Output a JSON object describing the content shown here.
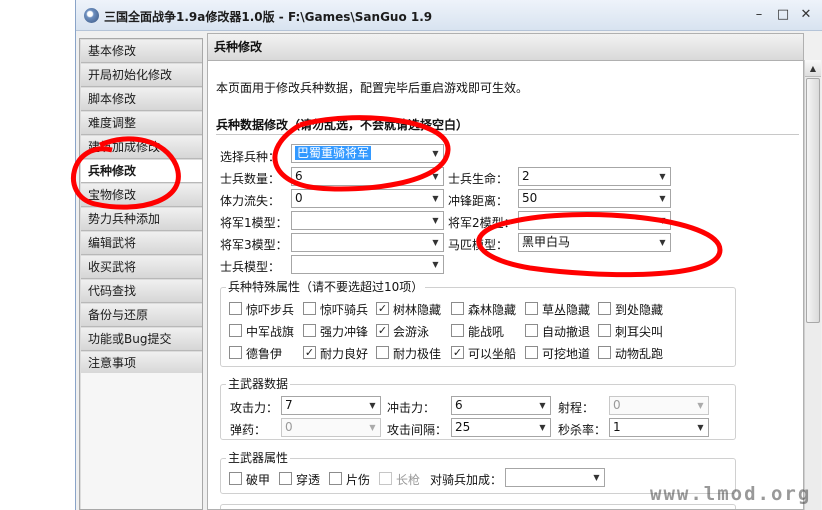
{
  "window": {
    "title": "三国全面战争1.9a修改器1.0版 - F:\\Games\\SanGuo 1.9",
    "minimize_glyph": "–",
    "maximize_glyph": "□",
    "close_glyph": "✕"
  },
  "sidebar": {
    "items": [
      {
        "label": "基本修改"
      },
      {
        "label": "开局初始化修改"
      },
      {
        "label": "脚本修改"
      },
      {
        "label": "难度调整"
      },
      {
        "label": "建筑加成修改"
      },
      {
        "label": "兵种修改",
        "active": true
      },
      {
        "label": "宝物修改"
      },
      {
        "label": "势力兵种添加"
      },
      {
        "label": "编辑武将"
      },
      {
        "label": "收买武将"
      },
      {
        "label": "代码查找"
      },
      {
        "label": "备份与还原"
      },
      {
        "label": "功能或Bug提交"
      },
      {
        "label": "注意事项"
      }
    ]
  },
  "page": {
    "title": "兵种修改",
    "description": "本页面用于修改兵种数据，配置完毕后重启游戏即可生效。",
    "section_title": "兵种数据修改（请勿乱选，不会就请选择空白）"
  },
  "unit_form": {
    "select_label": "选择兵种：",
    "select_value": "巴蜀重骑将军",
    "rows": [
      {
        "left_label": "士兵数量：",
        "left_value": "6",
        "right_label": "士兵生命：",
        "right_value": "2"
      },
      {
        "left_label": "体力流失：",
        "left_value": "0",
        "right_label": "冲锋距离：",
        "right_value": "50"
      },
      {
        "left_label": "将军1模型：",
        "left_value": "",
        "right_label": "将军2模型：",
        "right_value": ""
      },
      {
        "left_label": "将军3模型：",
        "left_value": "",
        "right_label": "马匹模型：",
        "right_value": "黑甲白马"
      },
      {
        "left_label": "士兵模型：",
        "left_value": ""
      }
    ]
  },
  "special_attributes": {
    "title": "兵种特殊属性（请不要选超过10项）",
    "items": [
      {
        "label": "惊吓步兵",
        "checked": false
      },
      {
        "label": "惊吓骑兵",
        "checked": false
      },
      {
        "label": "树林隐藏",
        "checked": true
      },
      {
        "label": "森林隐藏",
        "checked": false
      },
      {
        "label": "草丛隐藏",
        "checked": false
      },
      {
        "label": "到处隐藏",
        "checked": false
      },
      {
        "label": "中军战旗",
        "checked": false
      },
      {
        "label": "强力冲锋",
        "checked": false
      },
      {
        "label": "会游泳",
        "checked": true
      },
      {
        "label": "能战吼",
        "checked": false
      },
      {
        "label": "自动撤退",
        "checked": false
      },
      {
        "label": "刺耳尖叫",
        "checked": false
      },
      {
        "label": "德鲁伊",
        "checked": false
      },
      {
        "label": "耐力良好",
        "checked": true
      },
      {
        "label": "耐力极佳",
        "checked": false
      },
      {
        "label": "可以坐船",
        "checked": true
      },
      {
        "label": "可挖地道",
        "checked": false
      },
      {
        "label": "动物乱跑",
        "checked": false
      }
    ]
  },
  "primary_weapon_data": {
    "title": "主武器数据",
    "fields": [
      {
        "label": "攻击力：",
        "value": "7",
        "disabled": false
      },
      {
        "label": "冲击力：",
        "value": "6",
        "disabled": false
      },
      {
        "label": "射程：",
        "value": "0",
        "disabled": true
      },
      {
        "label": "弹药：",
        "value": "0",
        "disabled": true
      },
      {
        "label": "攻击间隔：",
        "value": "25",
        "disabled": false
      },
      {
        "label": "秒杀率：",
        "value": "1",
        "disabled": false
      }
    ]
  },
  "primary_weapon_attrs": {
    "title": "主武器属性",
    "items": [
      {
        "label": "破甲",
        "checked": false,
        "disabled": false
      },
      {
        "label": "穿透",
        "checked": false,
        "disabled": false
      },
      {
        "label": "片伤",
        "checked": false,
        "disabled": false
      },
      {
        "label": "长枪",
        "checked": false,
        "disabled": true
      }
    ],
    "cavalry_bonus_label": "对骑兵加成：",
    "cavalry_bonus_value": ""
  },
  "watermark": "www.lmod.org",
  "annotation_color": "#ff0000"
}
